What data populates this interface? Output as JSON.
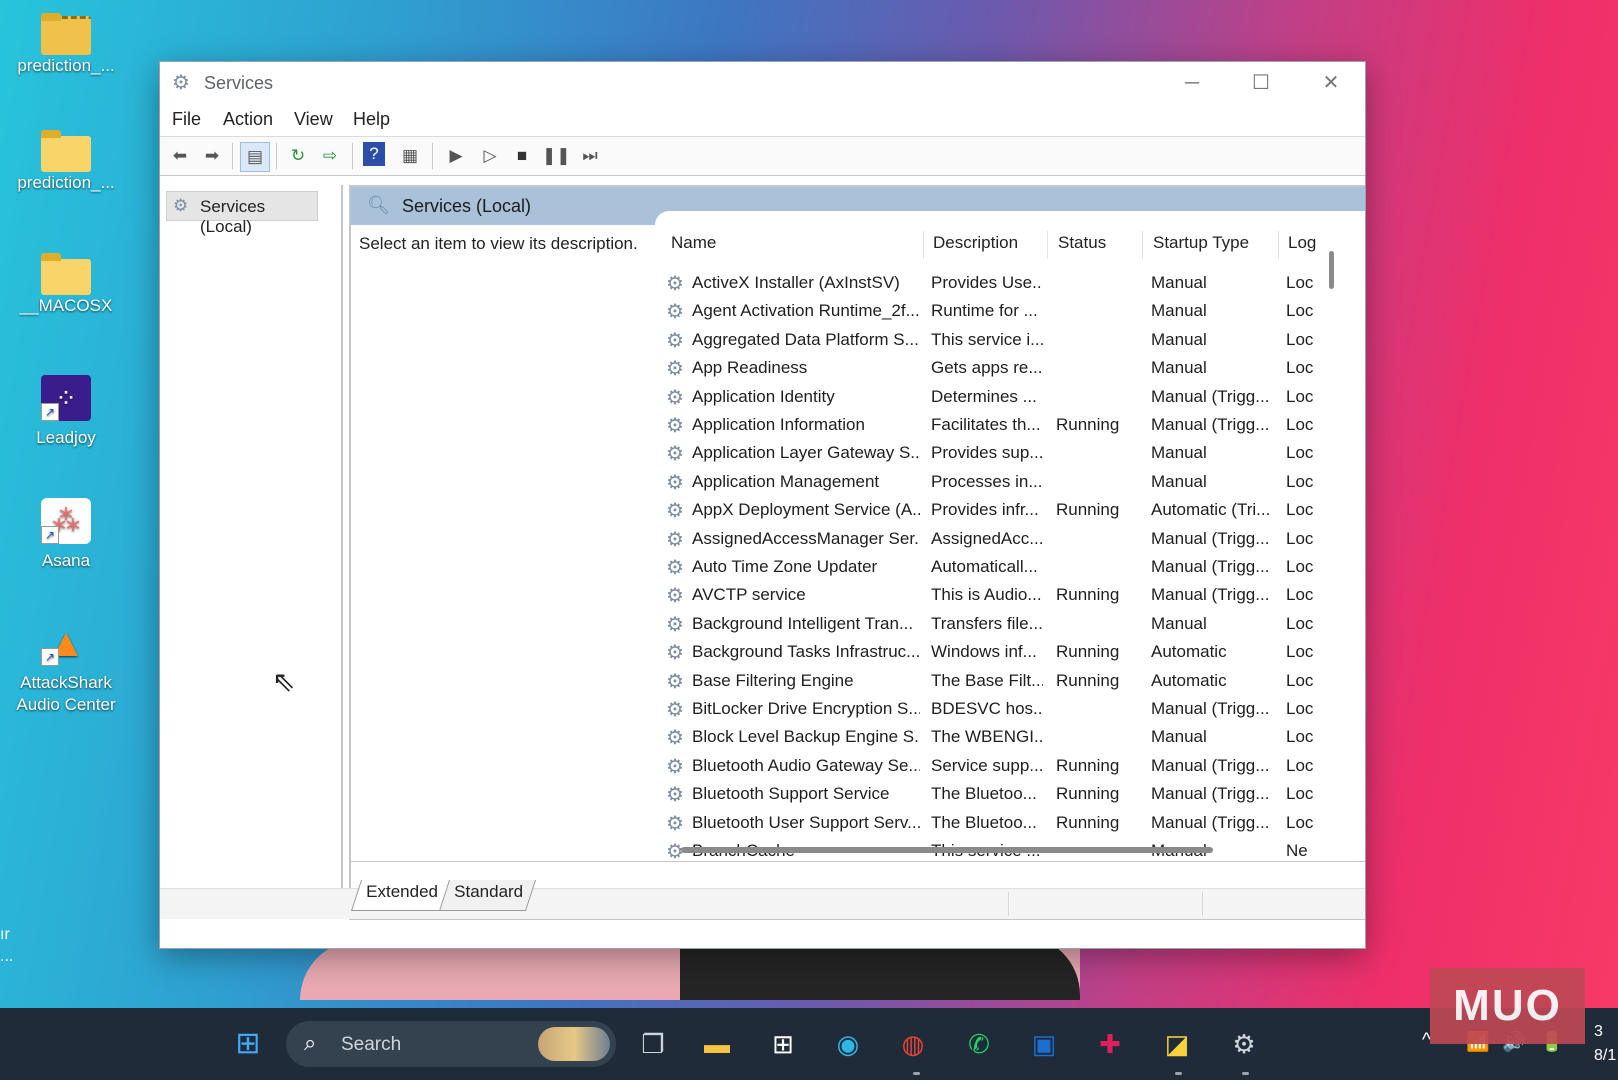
{
  "desktop": {
    "icons": [
      {
        "label": "prediction_...",
        "icon": "zip-folder-icon"
      },
      {
        "label": "prediction_...",
        "icon": "folder-icon"
      },
      {
        "label": "__MACOSX",
        "icon": "folder-icon"
      },
      {
        "label": "Leadjoy",
        "icon": "leadjoy-app-icon"
      },
      {
        "label": "Asana",
        "icon": "asana-app-icon"
      },
      {
        "label": "AttackShark Audio Center",
        "icon": "attackshark-app-icon"
      }
    ],
    "edge_text": "ır ..."
  },
  "window": {
    "title": "Services",
    "controls": {
      "minimize": "─",
      "maximize": "☐",
      "close": "✕"
    },
    "menu": [
      "File",
      "Action",
      "View",
      "Help"
    ],
    "toolbar_icons": [
      "back-arrow-icon",
      "forward-arrow-icon",
      "show-hide-console-tree-icon",
      "refresh-icon",
      "export-list-icon",
      "help-icon",
      "properties-icon",
      "start-service-icon",
      "start-service-alt-icon",
      "stop-service-icon",
      "pause-service-icon",
      "resume-service-icon"
    ],
    "tree": {
      "item": "Services (Local)"
    },
    "panel": {
      "header": "Services (Local)",
      "hint": "Select an item to view its description.",
      "columns": {
        "name": "Name",
        "description": "Description",
        "status": "Status",
        "startup": "Startup Type",
        "logon": "Log"
      },
      "rows": [
        {
          "name": "ActiveX Installer (AxInstSV)",
          "description": "Provides Use...",
          "status": "",
          "startup": "Manual",
          "logon": "Loc"
        },
        {
          "name": "Agent Activation Runtime_2f...",
          "description": "Runtime for ...",
          "status": "",
          "startup": "Manual",
          "logon": "Loc"
        },
        {
          "name": "Aggregated Data Platform S...",
          "description": "This service i...",
          "status": "",
          "startup": "Manual",
          "logon": "Loc"
        },
        {
          "name": "App Readiness",
          "description": "Gets apps re...",
          "status": "",
          "startup": "Manual",
          "logon": "Loc"
        },
        {
          "name": "Application Identity",
          "description": "Determines ...",
          "status": "",
          "startup": "Manual (Trigg...",
          "logon": "Loc"
        },
        {
          "name": "Application Information",
          "description": "Facilitates th...",
          "status": "Running",
          "startup": "Manual (Trigg...",
          "logon": "Loc"
        },
        {
          "name": "Application Layer Gateway S...",
          "description": "Provides sup...",
          "status": "",
          "startup": "Manual",
          "logon": "Loc"
        },
        {
          "name": "Application Management",
          "description": "Processes in...",
          "status": "",
          "startup": "Manual",
          "logon": "Loc"
        },
        {
          "name": "AppX Deployment Service (A...",
          "description": "Provides infr...",
          "status": "Running",
          "startup": "Automatic (Tri...",
          "logon": "Loc"
        },
        {
          "name": "AssignedAccessManager Ser...",
          "description": "AssignedAcc...",
          "status": "",
          "startup": "Manual (Trigg...",
          "logon": "Loc"
        },
        {
          "name": "Auto Time Zone Updater",
          "description": "Automaticall...",
          "status": "",
          "startup": "Manual (Trigg...",
          "logon": "Loc"
        },
        {
          "name": "AVCTP service",
          "description": "This is Audio...",
          "status": "Running",
          "startup": "Manual (Trigg...",
          "logon": "Loc"
        },
        {
          "name": "Background Intelligent Tran...",
          "description": "Transfers file...",
          "status": "",
          "startup": "Manual",
          "logon": "Loc"
        },
        {
          "name": "Background Tasks Infrastruc...",
          "description": "Windows inf...",
          "status": "Running",
          "startup": "Automatic",
          "logon": "Loc"
        },
        {
          "name": "Base Filtering Engine",
          "description": "The Base Filt...",
          "status": "Running",
          "startup": "Automatic",
          "logon": "Loc"
        },
        {
          "name": "BitLocker Drive Encryption S...",
          "description": "BDESVC hos...",
          "status": "",
          "startup": "Manual (Trigg...",
          "logon": "Loc"
        },
        {
          "name": "Block Level Backup Engine S...",
          "description": "The WBENGI...",
          "status": "",
          "startup": "Manual",
          "logon": "Loc"
        },
        {
          "name": "Bluetooth Audio Gateway Se...",
          "description": "Service supp...",
          "status": "Running",
          "startup": "Manual (Trigg...",
          "logon": "Loc"
        },
        {
          "name": "Bluetooth Support Service",
          "description": "The Bluetoo...",
          "status": "Running",
          "startup": "Manual (Trigg...",
          "logon": "Loc"
        },
        {
          "name": "Bluetooth User Support Serv...",
          "description": "The Bluetoo...",
          "status": "Running",
          "startup": "Manual (Trigg...",
          "logon": "Loc"
        },
        {
          "name": "BranchCache",
          "description": "This service ...",
          "status": "",
          "startup": "Manual",
          "logon": "Ne"
        }
      ]
    },
    "tabs": [
      "Extended",
      "Standard"
    ],
    "active_tab": "Extended"
  },
  "taskbar": {
    "search_placeholder": "Search",
    "apps": [
      "windows-start-icon",
      "task-view-icon",
      "file-explorer-icon",
      "microsoft-store-icon",
      "edge-browser-icon",
      "chrome-browser-icon",
      "whatsapp-icon",
      "trello-icon",
      "slack-icon",
      "sticky-notes-icon",
      "settings-icon"
    ],
    "tray": {
      "chevron": "^",
      "wifi": "📶",
      "volume": "🔊",
      "battery": "🔋"
    },
    "clock_partial": "3",
    "date_partial": "8/1"
  },
  "watermark": "MUO",
  "colors": {
    "panel_header": "#a9c1d9",
    "taskbar": "#1f2b38",
    "watermark": "#bf4855"
  }
}
